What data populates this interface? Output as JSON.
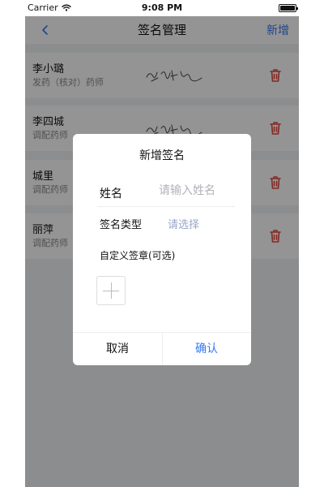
{
  "status_bar": {
    "carrier": "Carrier",
    "time": "9:08 PM",
    "wifi_icon": "wifi-icon",
    "battery_icon": "battery-icon"
  },
  "nav": {
    "title": "签名管理",
    "action_label": "新增",
    "back_icon": "chevron-left-icon"
  },
  "signatures": [
    {
      "name": "李小璐",
      "role": "发药（核对）药师"
    },
    {
      "name": "李四城",
      "role": "调配药师"
    },
    {
      "name": "城里",
      "role": "调配药师"
    },
    {
      "name": "丽萍",
      "role": "调配药师"
    }
  ],
  "dialog": {
    "title": "新增签名",
    "name_label": "姓名",
    "name_placeholder": "请输入姓名",
    "name_value": "",
    "type_label": "签名类型",
    "type_placeholder": "请选择",
    "custom_label": "自定义签章(可选)",
    "cancel_label": "取消",
    "confirm_label": "确认"
  },
  "colors": {
    "accent": "#3478f6",
    "danger": "#e0483d",
    "background": "#f2f3f5"
  }
}
